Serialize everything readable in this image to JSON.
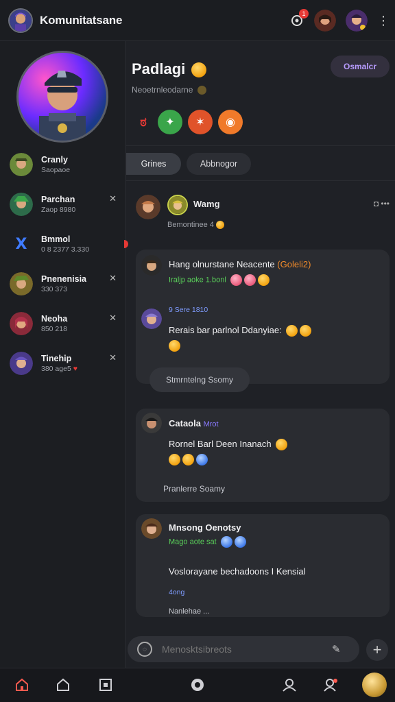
{
  "app": {
    "title": "Komunitatsane",
    "notification_count": "1"
  },
  "sidebar": {
    "contacts": [
      {
        "name": "Cranly",
        "sub": "Saopaoe"
      },
      {
        "name": "Parchan",
        "sub": "Zaop 8980"
      },
      {
        "name": "Bmmol",
        "sub": "0 8 2377 3.330"
      },
      {
        "name": "Pnenenisia",
        "sub": "330 373"
      },
      {
        "name": "Neoha",
        "sub": "850 218"
      },
      {
        "name": "Tinehip",
        "sub": "380 age5"
      }
    ]
  },
  "header": {
    "title": "Padlagi",
    "subtitle": "Neoetrnleodarne",
    "connect_label": "Osmalcr"
  },
  "tabs": [
    {
      "label": "Grines",
      "active": true
    },
    {
      "label": "Abbnogor",
      "active": false
    }
  ],
  "feed": {
    "author": "Wamg",
    "author_sub": "Bemontinee 4"
  },
  "messages": [
    {
      "title": "Hang olnurstane Neacente",
      "tag": "(Goleli2)",
      "meta": "Iraljp aoke 1.bonl",
      "time": "9 Sere 1810",
      "body": "Rerais bar parlnol Ddanyiae:",
      "reply_label": "Stmrntelng Ssomy"
    },
    {
      "author": "Cataola",
      "author_tag": "Mrot",
      "body": "Rornel Barl Deen Inanach",
      "reply_label": "Pranlerre Soamy"
    },
    {
      "author": "Mnsong Oenotsy",
      "meta": "Mago aote sat",
      "body": "Voslorayane bechadoons I Kensial",
      "time": "4ong",
      "more": "Nanlehae ..."
    }
  ],
  "composer": {
    "placeholder": "Menosktsibreots"
  },
  "colors": {
    "accent": "#b89cff",
    "background": "#1f2126",
    "active_nav": "#ff5a4f",
    "green_meta": "#5ad15a"
  },
  "icons": {
    "nav": [
      "home-active-icon",
      "home-icon",
      "square-icon",
      "circle-icon",
      "user-icon",
      "user-add-icon"
    ]
  }
}
